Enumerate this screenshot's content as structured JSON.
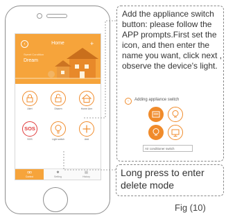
{
  "app": {
    "header": {
      "title": "Home",
      "subtitle": "Sweet Condition",
      "name": "Dream",
      "back_icon": "back-icon",
      "add_icon": "plus-icon"
    },
    "tiles": [
      {
        "label": "Alert",
        "icon": "lock-icon"
      },
      {
        "label": "Disarm",
        "icon": "unlock-icon"
      },
      {
        "label": "Home Arm",
        "icon": "house-icon"
      },
      {
        "label": "SOS",
        "icon": "sos-icon"
      },
      {
        "label": "Light switch",
        "icon": "bulb-icon"
      },
      {
        "label": "Add",
        "icon": "plus-icon"
      }
    ],
    "tabs": [
      {
        "label": "Control",
        "icon": "control-icon"
      },
      {
        "label": "Setting",
        "icon": "setting-icon"
      },
      {
        "label": "History",
        "icon": "history-icon"
      }
    ]
  },
  "callout1": {
    "text": "Add the appliance switch button: please follow the APP prompts.First set the icon, and then enter the name you want, click next , observe the device's light.",
    "mini_title": "Adding appliance switch",
    "options": [
      "appliance-icon",
      "bulb-icon",
      "bulb-icon",
      "monitor-icon"
    ],
    "input_value": "Air conditioner switch"
  },
  "callout2": {
    "text": "Long press to enter delete mode"
  },
  "figure_label": "Fig (10)",
  "colors": {
    "accent": "#f6a43b",
    "sos": "#e03b3b"
  }
}
